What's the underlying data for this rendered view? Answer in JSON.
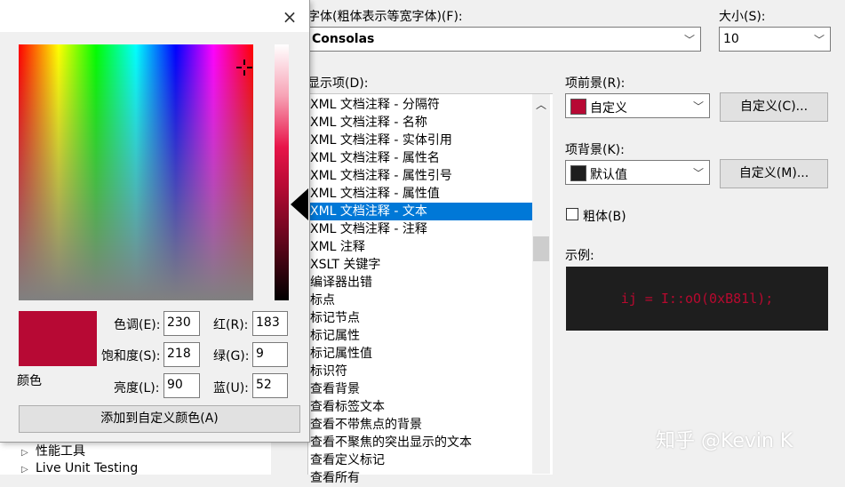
{
  "color_dialog": {
    "close_glyph": "×",
    "preview_label": "颜色",
    "hue_label": "色调(E):",
    "hue_value": "230",
    "sat_label": "饱和度(S):",
    "sat_value": "218",
    "lum_label": "亮度(L):",
    "lum_value": "90",
    "red_label": "红(R):",
    "red_value": "183",
    "green_label": "绿(G):",
    "green_value": "9",
    "blue_label": "蓝(U):",
    "blue_value": "52",
    "add_button": "添加到自定义颜色(A)",
    "current_color": "#b70934"
  },
  "background_tree": {
    "items": [
      "性能工具",
      "Live Unit Testing"
    ]
  },
  "fonts_colors": {
    "font_label": "字体(粗体表示等宽字体)(F):",
    "font_value": "Consolas",
    "size_label": "大小(S):",
    "size_value": "10",
    "display_items_label": "显示项(D):",
    "display_items": [
      "XML 文档注释 - 分隔符",
      "XML 文档注释 - 名称",
      "XML 文档注释 - 实体引用",
      "XML 文档注释 - 属性名",
      "XML 文档注释 - 属性引号",
      "XML 文档注释 - 属性值",
      "XML 文档注释 - 文本",
      "XML 文档注释 - 注释",
      "XML 注释",
      "XSLT 关键字",
      "编译器出错",
      "标点",
      "标记节点",
      "标记属性",
      "标记属性值",
      "标识符",
      "查看背景",
      "查看标签文本",
      "查看不带焦点的背景",
      "查看不聚焦的突出显示的文本",
      "查看定义标记",
      "查看所有"
    ],
    "selected_index": 6,
    "foreground_label": "项前景(R):",
    "foreground_value": "自定义",
    "foreground_swatch": "#b70934",
    "foreground_custom_button": "自定义(C)...",
    "background_label": "项背景(K):",
    "background_value": "默认值",
    "background_swatch": "#1e1e1e",
    "background_custom_button": "自定义(M)...",
    "bold_label": "粗体(B)",
    "sample_label": "示例:",
    "sample_text": "ij = I::oO(0xB81l);"
  },
  "watermark": "知乎 @Kevin K"
}
